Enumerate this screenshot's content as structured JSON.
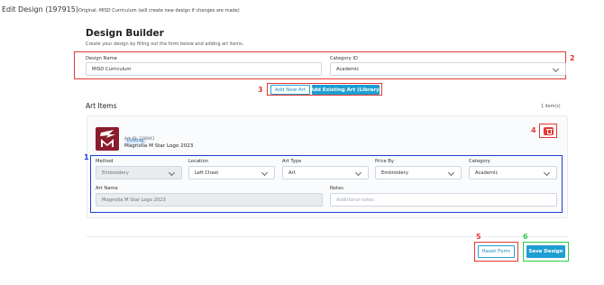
{
  "header": {
    "edit_title": "Edit Design (197915)",
    "original_note": "Original: MISD Curriculum (will create new design if changes are made)"
  },
  "builder": {
    "title": "Design Builder",
    "subtitle": "Create your design by filling out the form below and adding art items."
  },
  "form": {
    "design_name_label": "Design Name",
    "design_name_value": "MISD Curriculum",
    "category_label": "Category ID",
    "category_value": "Academic"
  },
  "actions": {
    "add_new_art": "Add New Art",
    "add_existing_art": "Add Existing Art (Library)"
  },
  "art_items": {
    "title": "Art Items",
    "count": "1 item(s)",
    "item": {
      "badge": "Existing",
      "art_id": "Art ID: 228941",
      "name": "Magnolia M Star Logo 2023",
      "fields": {
        "method_label": "Method",
        "method_value": "Embroidery",
        "location_label": "Location",
        "location_value": "Left Chest",
        "art_type_label": "Art Type",
        "art_type_value": "Art",
        "price_by_label": "Price By",
        "price_by_value": "Embroidery",
        "category_label": "Category",
        "category_value": "Academic",
        "art_name_label": "Art Name",
        "art_name_value": "Magnolia M Star Logo 2023",
        "notes_label": "Notes",
        "notes_placeholder": "Additional notes"
      }
    }
  },
  "footer": {
    "reset_label": "Reset Form",
    "save_label": "Save Design"
  },
  "annotations": {
    "n1": "1",
    "n2": "2",
    "n3": "3",
    "n4": "4",
    "n5": "5",
    "n6": "6"
  },
  "colors": {
    "accent": "#1f9ed1",
    "annotation_red": "#e53935",
    "annotation_blue": "#1e40d6",
    "annotation_green": "#2ecc40",
    "logo_bg": "#8a1c2b"
  },
  "icons": [
    "chevron-down-icon",
    "trash-icon",
    "logo-m-star"
  ]
}
